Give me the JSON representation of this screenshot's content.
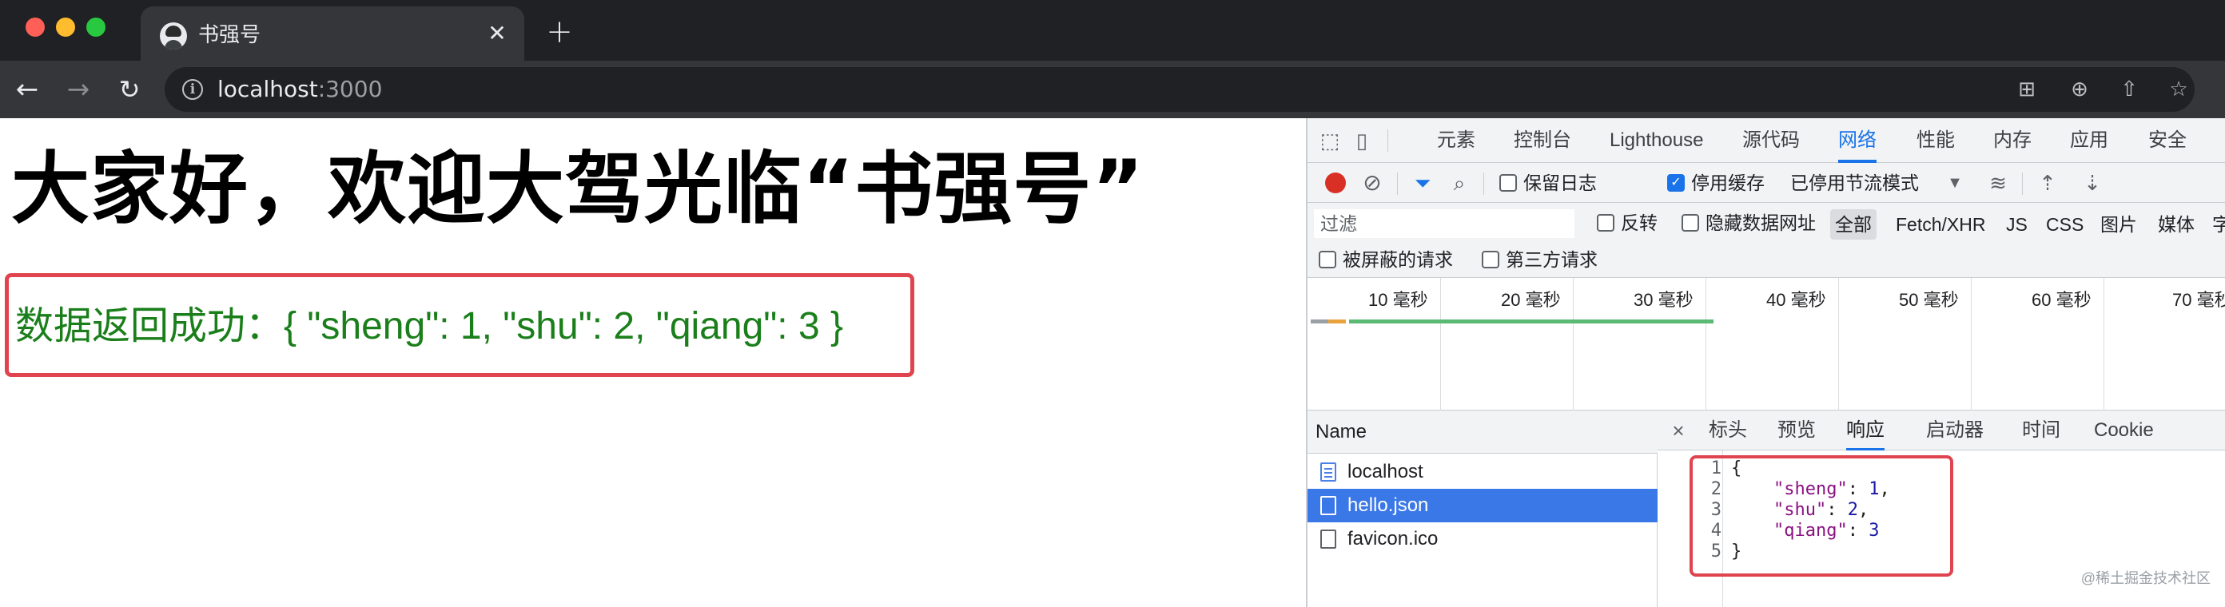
{
  "browser": {
    "tab_title": "书强号",
    "tab_close": "✕",
    "new_tab": "+",
    "url_host": "localhost",
    "url_port": ":3000"
  },
  "page": {
    "title": "大家好，欢迎大驾光临“书强号”",
    "result_text": "数据返回成功：{ \"sheng\": 1, \"shu\": 2, \"qiang\": 3 }"
  },
  "devtools": {
    "tabs": [
      "元素",
      "控制台",
      "Lighthouse",
      "源代码",
      "网络",
      "性能",
      "内存",
      "应用",
      "安全"
    ],
    "active_tab": "网络",
    "toolbar": {
      "preserve_log": "保留日志",
      "disable_cache": "停用缓存",
      "throttling": "已停用节流模式"
    },
    "filter": {
      "placeholder": "过滤",
      "invert": "反转",
      "hide_data_urls": "隐藏数据网址",
      "types": [
        "全部",
        "Fetch/XHR",
        "JS",
        "CSS",
        "图片",
        "媒体",
        "字"
      ],
      "blocked_requests": "被屏蔽的请求",
      "third_party": "第三方请求"
    },
    "timeline": {
      "ticks": [
        "10 毫秒",
        "20 毫秒",
        "30 毫秒",
        "40 毫秒",
        "50 毫秒",
        "60 毫秒",
        "70 毫秒"
      ]
    },
    "requests": {
      "header": "Name",
      "items": [
        "localhost",
        "hello.json",
        "favicon.ico"
      ],
      "selected": "hello.json"
    },
    "detail": {
      "close": "×",
      "tabs": [
        "标头",
        "预览",
        "响应",
        "启动器",
        "时间",
        "Cookie"
      ],
      "active_tab": "响应",
      "lines": [
        {
          "n": "1",
          "pre": "{",
          "key": "",
          "sep": "",
          "val": "",
          "post": ""
        },
        {
          "n": "2",
          "pre": "    ",
          "key": "\"sheng\"",
          "sep": ": ",
          "val": "1",
          "post": ","
        },
        {
          "n": "3",
          "pre": "    ",
          "key": "\"shu\"",
          "sep": ": ",
          "val": "2",
          "post": ","
        },
        {
          "n": "4",
          "pre": "    ",
          "key": "\"qiang\"",
          "sep": ": ",
          "val": "3",
          "post": ""
        },
        {
          "n": "5",
          "pre": "}",
          "key": "",
          "sep": "",
          "val": "",
          "post": ""
        }
      ]
    },
    "watermark": "@稀土掘金技术社区"
  },
  "colors": {
    "highlight_box": "#e0444e",
    "result_green": "#1a7f1a",
    "devtools_accent": "#1a73e8",
    "selected_row": "#3b78e7"
  }
}
